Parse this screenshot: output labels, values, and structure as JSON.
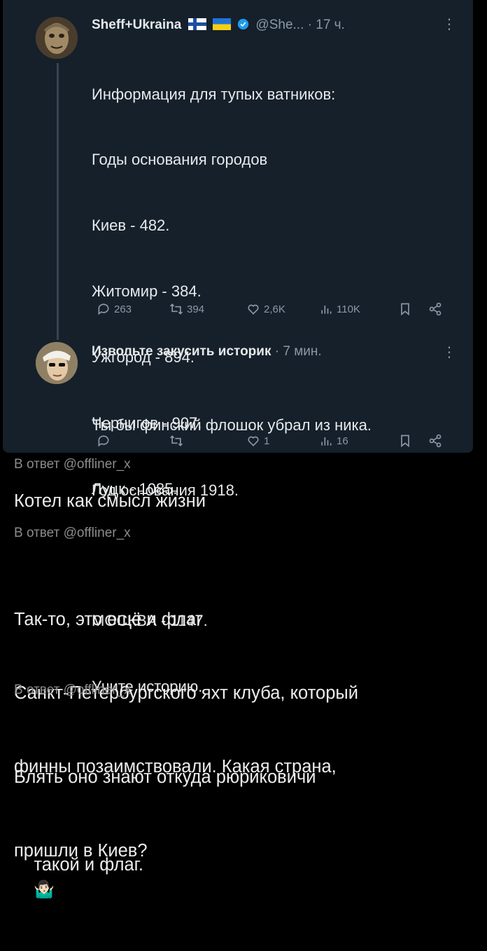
{
  "tweet1": {
    "author_name": "Sheff+Ukraina",
    "handle": "@She...",
    "time": "· 17 ч.",
    "lines": [
      "Информация для тупых ватников:",
      "Годы основания городов",
      "Киев - 482.",
      "Житомир - 384.",
      "Ужгород - 894.",
      "Чернигов - 907.",
      "Луцк - 1085.",
      "",
      "МОСКВА - 1147.",
      "Учите историю."
    ],
    "replies": "263",
    "retweets": "394",
    "likes": "2,6K",
    "views": "110K"
  },
  "tweet2": {
    "author_name": "Извольте закусить историк",
    "time": "· 7 мин.",
    "lines": [
      "Ты бы финский флошок убрал из ника.",
      "Год основания 1918."
    ],
    "replies": "",
    "retweets": "",
    "likes": "1",
    "views": "16"
  },
  "comments": [
    {
      "reply_prefix": "В ответ",
      "reply_handle": "@offliner_x",
      "text": "Котел как смысл жизни"
    },
    {
      "reply_prefix": "В ответ",
      "reply_handle": "@offliner_x",
      "text_lines": [
        "Так-то, это ещё и флаг",
        "Санкт-Петербургского яхт клуба, который",
        "финны позаимствовали. Какая страна,",
        "такой и флаг."
      ],
      "emoji": "🤷🏻‍♂️"
    },
    {
      "reply_prefix": "В ответ",
      "reply_handle": "@offliner_x",
      "text_lines": [
        "Блять оно знают откуда рюриковичи",
        "пришли в Киев?"
      ]
    }
  ],
  "colors": {
    "card_bg": "#15202b",
    "muted": "#8b98a5",
    "verified": "#1d9bf0",
    "page_bg": "#000000"
  }
}
